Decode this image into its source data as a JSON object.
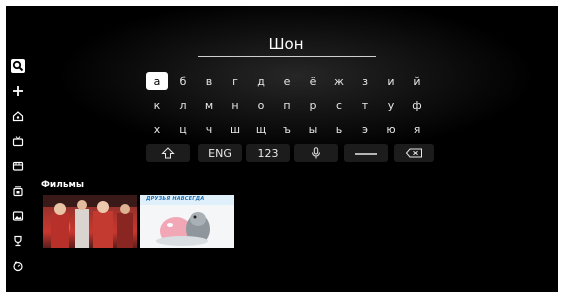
{
  "search": {
    "query": "Шон"
  },
  "sidebar": {
    "items": [
      {
        "icon": "search-icon",
        "active": true
      },
      {
        "icon": "plus-icon"
      },
      {
        "icon": "home-icon"
      },
      {
        "icon": "tv-icon"
      },
      {
        "icon": "film-icon"
      },
      {
        "icon": "collections-icon"
      },
      {
        "icon": "picture-icon"
      },
      {
        "icon": "trophy-icon"
      },
      {
        "icon": "clock-icon"
      }
    ]
  },
  "keyboard": {
    "selected": "а",
    "rows": [
      [
        "а",
        "б",
        "в",
        "г",
        "д",
        "е",
        "ё",
        "ж",
        "з",
        "и",
        "й"
      ],
      [
        "к",
        "л",
        "м",
        "н",
        "о",
        "п",
        "р",
        "с",
        "т",
        "у",
        "ф"
      ],
      [
        "х",
        "ц",
        "ч",
        "ш",
        "щ",
        "ъ",
        "ы",
        "ь",
        "э",
        "ю",
        "я"
      ]
    ],
    "function_keys": {
      "shift": "shift-icon",
      "language": "ENG",
      "numbers": "123",
      "voice": "microphone-icon",
      "space": "space-icon",
      "backspace": "backspace-icon"
    }
  },
  "results": {
    "title": "Фильмы",
    "items": [
      {
        "poster": "movie-poster-1"
      },
      {
        "poster": "movie-poster-2",
        "caption": "ДРУЗЬЯ НАВСЕГДА"
      }
    ]
  },
  "colors": {
    "background": "#000000",
    "selected_key": "#ffffff",
    "function_key": "#1c1c1c",
    "text": "#ffffff"
  }
}
